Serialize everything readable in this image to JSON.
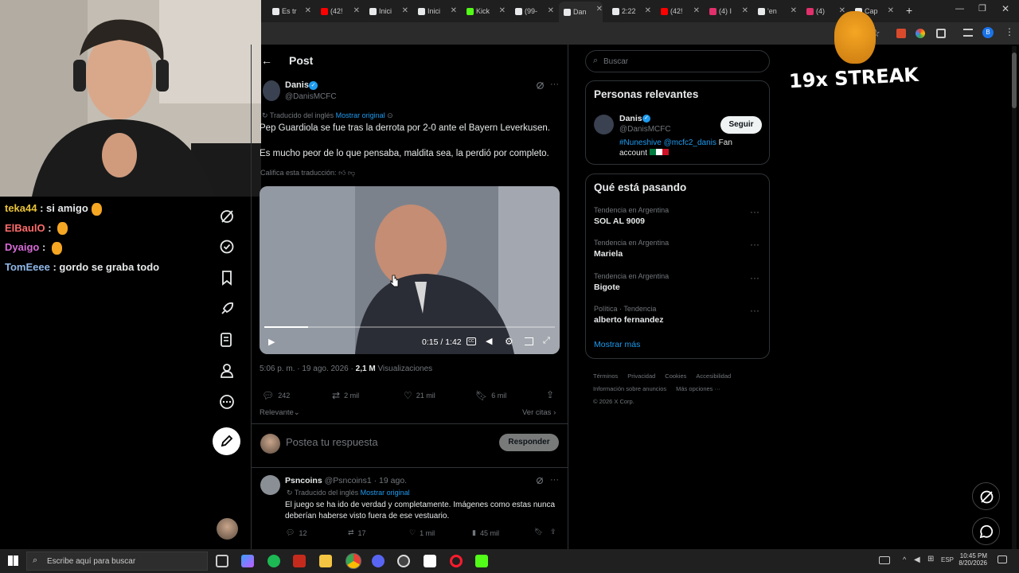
{
  "browser": {
    "tabs": [
      {
        "label": "Es tr",
        "icon": "x-icon"
      },
      {
        "label": "(42!",
        "icon": "youtube-icon"
      },
      {
        "label": "Inici",
        "icon": "x-icon"
      },
      {
        "label": "Inici",
        "icon": "x-icon"
      },
      {
        "label": "Kick",
        "icon": "kick-icon"
      },
      {
        "label": "(99-",
        "icon": "tiktok-icon"
      },
      {
        "label": "Dan",
        "icon": "x-icon"
      },
      {
        "label": "2:22",
        "icon": "x-icon"
      },
      {
        "label": "(42!",
        "icon": "youtube-icon"
      },
      {
        "label": "(4) I",
        "icon": "instagram-icon"
      },
      {
        "label": "'en",
        "icon": "x-icon"
      },
      {
        "label": "(4)",
        "icon": "instagram-icon"
      },
      {
        "label": "Cap",
        "icon": "x-icon"
      }
    ],
    "profile_initial": "B"
  },
  "overlay": {
    "streak_text": "19x STREAK"
  },
  "chat": [
    {
      "user": "teka44",
      "color": "#e8c23a",
      "message": "si amigo"
    },
    {
      "user": "ElBaulO",
      "color": "#ff6b6b",
      "message": ""
    },
    {
      "user": "Dyaigo",
      "color": "#d86bd8",
      "message": ""
    },
    {
      "user": "TomEeee",
      "color": "#8fb8e8",
      "message": "gordo se graba todo"
    }
  ],
  "post_header": {
    "title": "Post"
  },
  "post": {
    "author": "Danis",
    "handle": "@DanisMCFC",
    "translated_note": "Traducido del inglés",
    "show_original": "Mostrar original",
    "text_1": "Pep Guardiola se fue tras la derrota por 2-0 ante el Bayern Leverkusen.",
    "text_2": "Es mucho peor de lo que pensaba, maldita sea, la perdió por completo.",
    "rate_translation": "Califica esta traducción:",
    "video_time": "0:15 / 1:42",
    "video_progress": 0.15,
    "timestamp": "5:06 p. m. · 19 ago. 2026",
    "views_count": "2,1 M",
    "views_label": "Visualizaciones",
    "replies": "242",
    "reposts": "2 mil",
    "likes": "21 mil",
    "bookmarks": "6 mil",
    "sort": "Relevante",
    "view_quotes": "Ver citas"
  },
  "reply_box": {
    "placeholder": "Postea tu respuesta",
    "button": "Responder"
  },
  "reply": {
    "author": "Psncoins",
    "handle": "@Psncoins1 · 19 ago.",
    "translated_note": "Traducido del inglés",
    "show_original": "Mostrar original",
    "text": "El juego se ha ido de verdad y completamente. Imágenes como estas nunca deberían haberse visto fuera de ese vestuario.",
    "replies": "12",
    "reposts": "17",
    "likes": "1 mil",
    "views": "45 mil"
  },
  "search": {
    "placeholder": "Buscar"
  },
  "relevant": {
    "title": "Personas relevantes",
    "name": "Danis",
    "handle": "@DanisMCFC",
    "follow": "Seguir",
    "bio_tags": "#Nuneshive @mcfc2_danis",
    "bio_rest": "Fan account"
  },
  "trending": {
    "title": "Qué está pasando",
    "items": [
      {
        "context": "Tendencia en Argentina",
        "topic": "SOL AL 9009"
      },
      {
        "context": "Tendencia en Argentina",
        "topic": "Mariela"
      },
      {
        "context": "Tendencia en Argentina",
        "topic": "Bigote"
      },
      {
        "context": "Política · Tendencia",
        "topic": "alberto fernandez"
      }
    ],
    "show_more": "Mostrar más"
  },
  "footer": {
    "links_1": [
      "Términos",
      "Privacidad",
      "Cookies",
      "Accesibilidad"
    ],
    "links_2": [
      "Información sobre anuncios",
      "Más opciones ···"
    ],
    "copyright": "© 2026 X Corp."
  },
  "taskbar": {
    "search_placeholder": "Escribe aquí para buscar",
    "lang": "ESP",
    "time": "10:45 PM",
    "date": "8/20/2026"
  }
}
